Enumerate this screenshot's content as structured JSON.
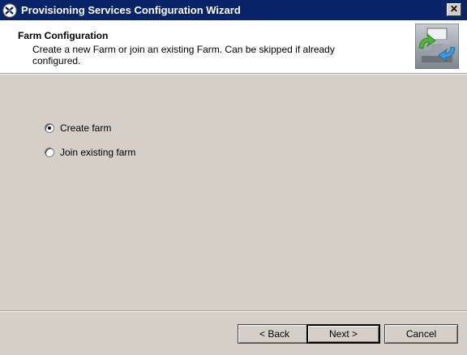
{
  "window": {
    "title": "Provisioning Services Configuration Wizard",
    "close_label": "✕"
  },
  "header": {
    "title": "Farm Configuration",
    "description": "Create a new Farm or join an existing Farm. Can be skipped if already configured."
  },
  "options": [
    {
      "label": "Create farm",
      "selected": true
    },
    {
      "label": "Join existing farm",
      "selected": false
    }
  ],
  "buttons": {
    "back": "< Back",
    "next": "Next >",
    "cancel": "Cancel"
  },
  "icons": {
    "app": "citrix-icon",
    "wizard_graphic": "server-sync-icon",
    "close": "close-icon"
  },
  "colors": {
    "titlebar": "#0a246a",
    "dialog_background": "#d4d0c8",
    "header_background": "#ffffff"
  }
}
